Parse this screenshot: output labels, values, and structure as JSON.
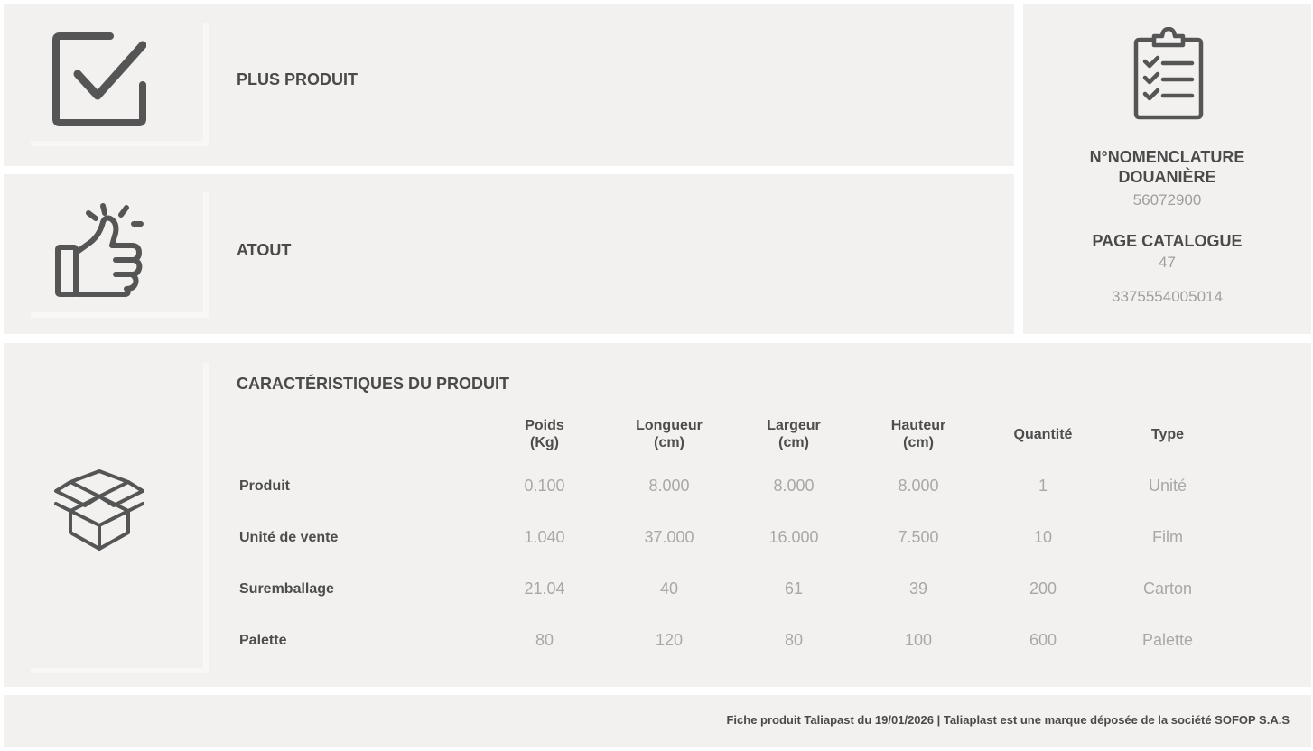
{
  "sections": {
    "plus_produit": {
      "title": "PLUS PRODUIT",
      "icon": "checkbox-icon"
    },
    "atout": {
      "title": "ATOUT",
      "icon": "thumbs-up-icon"
    },
    "caracteristiques": {
      "title": "CARACTÉRISTIQUES DU PRODUIT",
      "icon": "open-box-icon"
    }
  },
  "side_panel": {
    "icon": "clipboard-checklist-icon",
    "nomenclature_label_1": "N°NOMENCLATURE",
    "nomenclature_label_2": "DOUANIÈRE",
    "nomenclature_value": "56072900",
    "catalogue_label": "PAGE CATALOGUE",
    "catalogue_value": "47",
    "ean": "3375554005014"
  },
  "table": {
    "headers": [
      {
        "line1": "Poids",
        "line2": "(Kg)"
      },
      {
        "line1": "Longueur",
        "line2": "(cm)"
      },
      {
        "line1": "Largeur",
        "line2": "(cm)"
      },
      {
        "line1": "Hauteur",
        "line2": "(cm)"
      },
      {
        "line1": "Quantité",
        "line2": ""
      },
      {
        "line1": "Type",
        "line2": ""
      }
    ],
    "rows": [
      {
        "label": "Produit",
        "cells": [
          "0.100",
          "8.000",
          "8.000",
          "8.000",
          "1",
          "Unité"
        ]
      },
      {
        "label": "Unité de vente",
        "cells": [
          "1.040",
          "37.000",
          "16.000",
          "7.500",
          "10",
          "Film"
        ]
      },
      {
        "label": "Suremballage",
        "cells": [
          "21.04",
          "40",
          "61",
          "39",
          "200",
          "Carton"
        ]
      },
      {
        "label": "Palette",
        "cells": [
          "80",
          "120",
          "80",
          "100",
          "600",
          "Palette"
        ]
      }
    ]
  },
  "footer": {
    "text": "Fiche produit Taliapast du 19/01/2026 | Taliaplast est une marque déposée de la société SOFOP S.A.S"
  },
  "colors": {
    "panel": "#f2f1ef",
    "icon": "#555555",
    "muted_text": "#a8a8a8"
  }
}
